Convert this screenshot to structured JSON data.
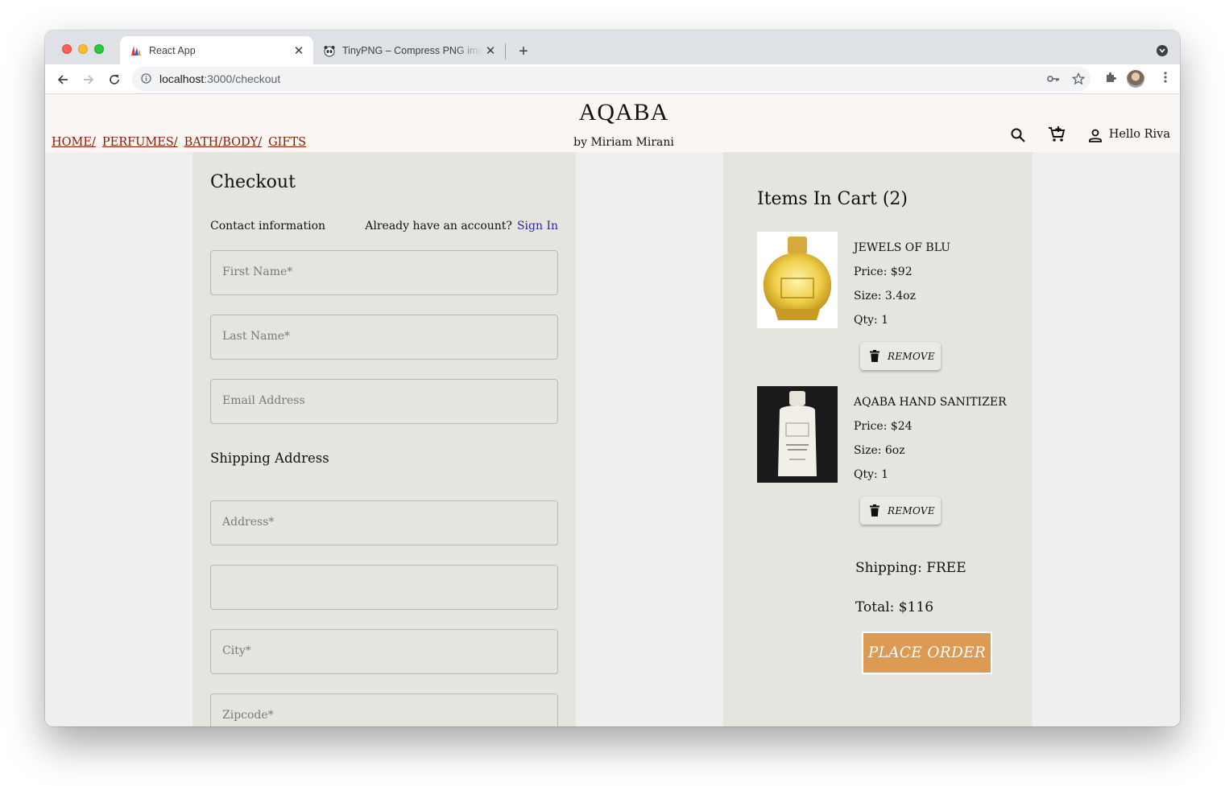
{
  "browser": {
    "tabs": [
      {
        "title": "React App",
        "active": true,
        "icon": "react-app-favicon"
      },
      {
        "title": "TinyPNG – Compress PNG images",
        "active": false,
        "icon": "panda-favicon"
      }
    ],
    "url_host": "localhost",
    "url_path": ":3000/checkout"
  },
  "header": {
    "brand": "AQABA",
    "byline": "by Miriam Mirani",
    "nav": [
      "HOME/",
      "PERFUMES/",
      "BATH/BODY/",
      "GIFTS"
    ],
    "greeting": "Hello Riva"
  },
  "checkout": {
    "title": "Checkout",
    "contact_label": "Contact information",
    "account_prompt": "Already have an account?",
    "sign_in": "Sign In",
    "fields": {
      "first_name": "First Name*",
      "last_name": "Last Name*",
      "email": "Email Address",
      "address": "Address*",
      "address2": "",
      "city": "City*",
      "zipcode": "Zipcode*"
    },
    "shipping_heading": "Shipping Address"
  },
  "cart": {
    "title": "Items In Cart (2)",
    "items": [
      {
        "name": "JEWELS OF BLU",
        "price": "Price: $92",
        "size": "Size: 3.4oz",
        "qty": "Qty: 1",
        "remove": "REMOVE"
      },
      {
        "name": "AQABA HAND SANITIZER",
        "price": "Price: $24",
        "size": "Size: 6oz",
        "qty": "Qty: 1",
        "remove": "REMOVE"
      }
    ],
    "shipping": "Shipping: FREE",
    "total": "Total: $116",
    "place_order": "PLACE ORDER",
    "accent": "#dc9a52"
  }
}
